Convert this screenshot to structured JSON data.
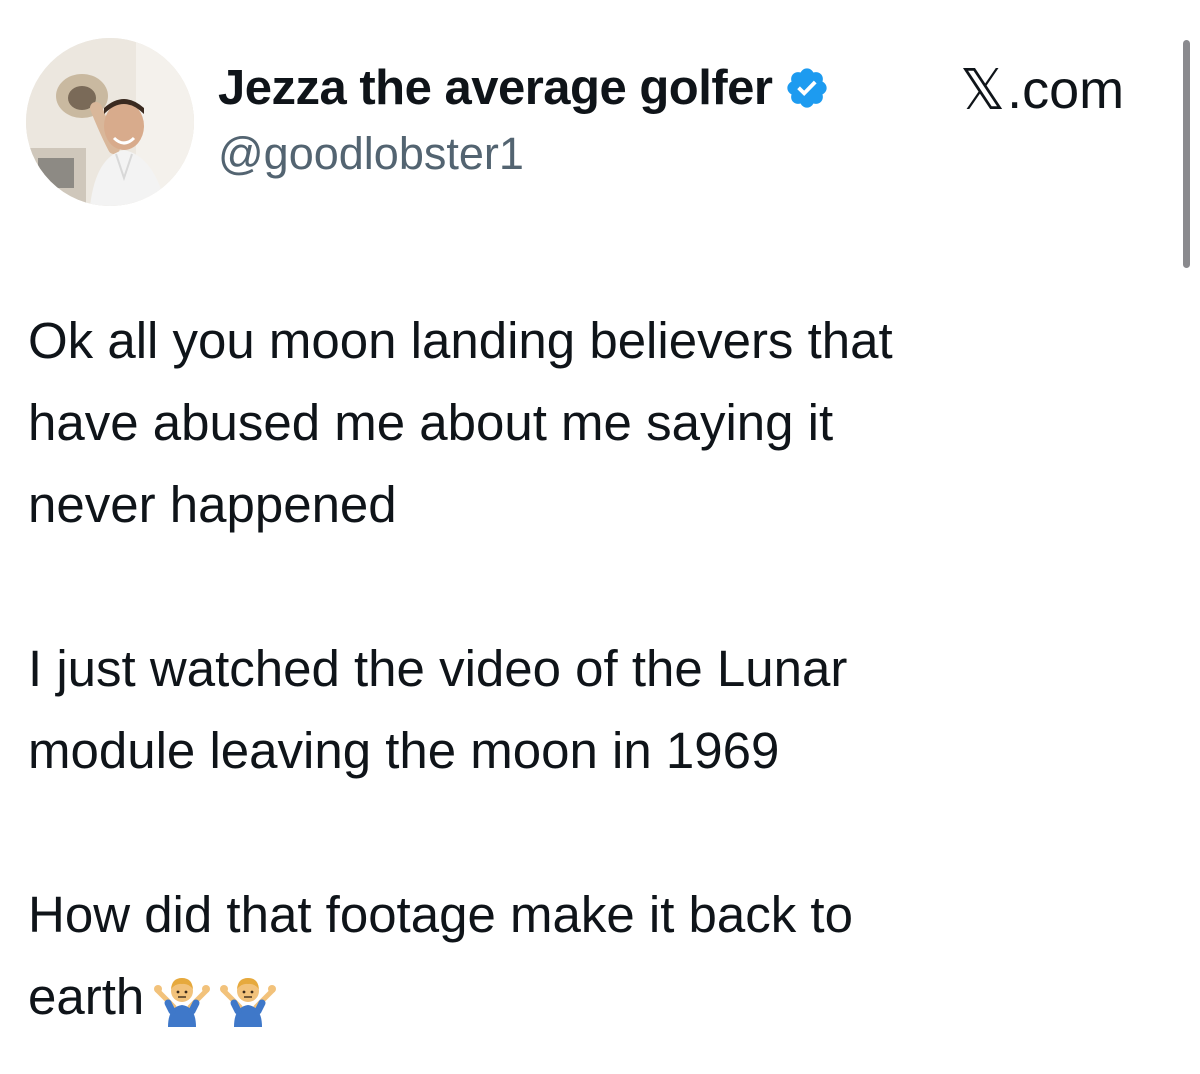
{
  "tweet": {
    "author": {
      "display_name": "Jezza the average golfer",
      "handle": "@goodlobster1",
      "verified": true,
      "avatar": "profile-photo"
    },
    "source": {
      "logo": "𝕏",
      "label": ".com"
    },
    "body": {
      "paragraph_1_line_1": "Ok all you moon landing believers that",
      "paragraph_1_line_2": "have abused me about me saying it",
      "paragraph_1_line_3": "never happened",
      "paragraph_2_line_1": "I just watched the video of the Lunar",
      "paragraph_2_line_2": "module leaving the moon in 1969",
      "paragraph_3_line_1": "How did that footage make it back to",
      "paragraph_3_line_2": "earth"
    },
    "emojis": [
      "man-shrugging-emoji",
      "man-shrugging-emoji"
    ]
  },
  "colors": {
    "text": "#0f1419",
    "secondary_text": "#536471",
    "verified_blue": "#1d9bf0",
    "background": "#ffffff"
  }
}
